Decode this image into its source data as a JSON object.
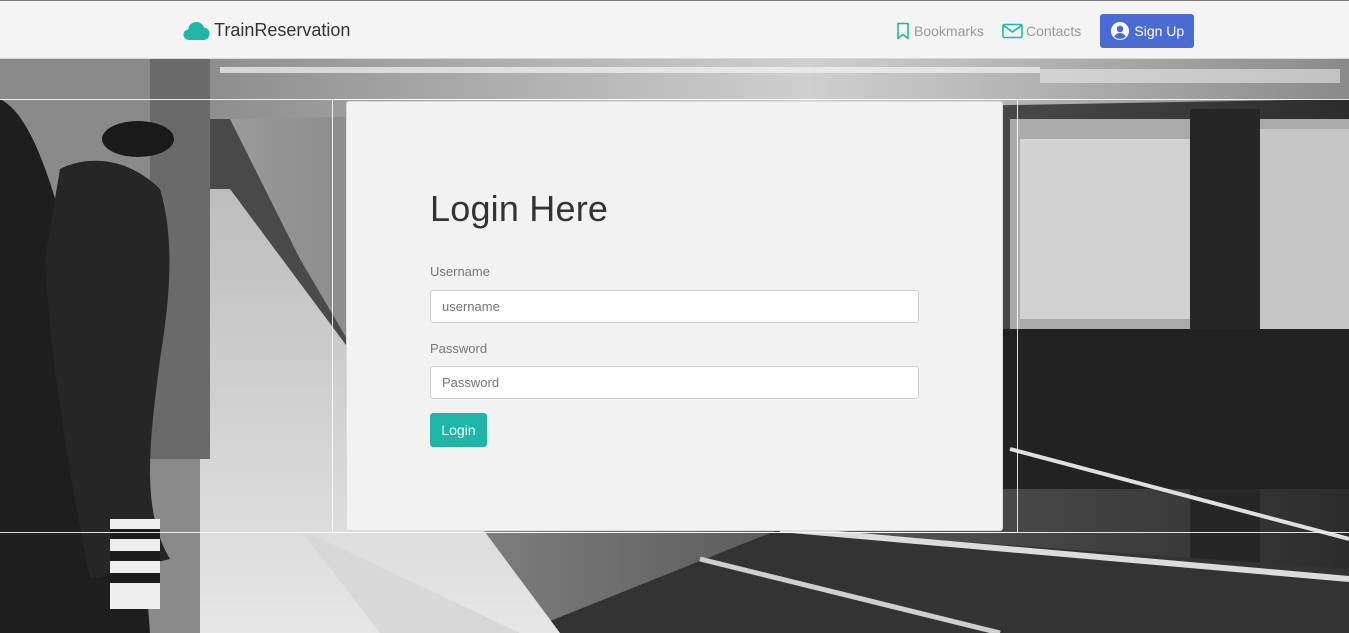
{
  "navbar": {
    "brand": "TrainReservation",
    "brand_icon": "cloud-icon",
    "brand_color": "#1fb5a7",
    "bookmarks_label": "Bookmarks",
    "contacts_label": "Contacts",
    "signup_label": "Sign Up",
    "signup_color": "#4b6bd4"
  },
  "login": {
    "title": "Login Here",
    "username_label": "Username",
    "username_placeholder": "username",
    "password_label": "Password",
    "password_placeholder": "Password",
    "button_label": "Login",
    "button_color": "#1fb5a7"
  }
}
